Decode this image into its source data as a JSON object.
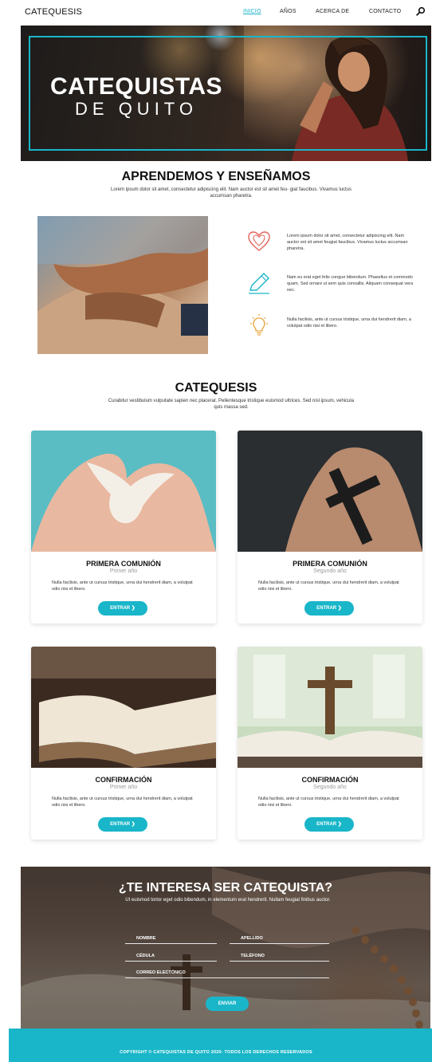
{
  "nav": {
    "brand": "CATEQUESIS",
    "items": [
      "INICIO",
      "AÑOS",
      "ACERCA DE",
      "CONTACTO"
    ],
    "active_index": 0,
    "search_icon": "search-icon"
  },
  "hero": {
    "title_line1": "CATEQUISTAS",
    "title_line2": "DE QUITO"
  },
  "about": {
    "title": "APRENDEMOS Y ENSEÑAMOS",
    "lead": "Lorem ipsum dolor sit amet, consectetur adipiscing elit. Nam auctor est sit amet feu- giat faucibus. Vivamus luctus accumsan pharetra.",
    "features": [
      {
        "icon": "hearts-icon",
        "text": "Lorem ipsum dolor sit amet, consectetur adipiscing elit. Nam auctor est sit amet feugiat faucibus. Vivamus luctus accumsan pharetra."
      },
      {
        "icon": "pencil-icon",
        "text": "Nam eu erat eget felis congue bibendum. Phasellus et commodo quam. Sed ornare ut sem quis convallis. Aliquam consequat vera nec."
      },
      {
        "icon": "lightbulb-icon",
        "text": "Nulla facilisis, ante ut cursus tristique, urna dui hendrerit diam, a volutpat odio nisi et libero."
      }
    ]
  },
  "catequesis": {
    "title": "CATEQUESIS",
    "lead": "Curabitur vestibulum vulputate sapien nec placerat. Pellentesque tristique euismod ultrices. Sed nisl ipsum, vehicula quis massa sed.",
    "cards": [
      {
        "title": "PRIMERA COMUNIÓN",
        "subtitle": "Primer año",
        "text": "Nulla facilisis, ante ut cursus tristique, urna dui hendrerit diam, a volutpat odio nisi et libero.",
        "button": "ENTRAR ❯"
      },
      {
        "title": "PRIMERA COMUNIÓN",
        "subtitle": "Segundo año",
        "text": "Nulla facilisis, ante ut cursus tristique, urna dui hendrerit diam, a volutpat odio nisi et libero.",
        "button": "ENTRAR ❯"
      },
      {
        "title": "CONFIRMACIÓN",
        "subtitle": "Primer año",
        "text": "Nulla facilisis, ante ut cursus tristique, urna dui hendrerit diam, a volutpat odio nisi et libero.",
        "button": "ENTRAR ❯"
      },
      {
        "title": "CONFIRMACIÓN",
        "subtitle": "Segundo año",
        "text": "Nulla facilisis, ante ut cursus tristique, urna dui hendrerit diam, a volutpat odio nisi et libero.",
        "button": "ENTRAR ❯"
      }
    ]
  },
  "contact": {
    "title": "¿TE INTERESA SER CATEQUISTA?",
    "lead": "Ut euismod tortor eget odio bibendum, in elementum erat hendrerit. Nullam feugiat finibus auctor.",
    "fields": {
      "nombre": "NOMBRE",
      "apellido": "APELLIDO",
      "cedula": "CÉDULA",
      "telefono": "TELÉFONO",
      "correo": "CORREO ELECTÓNICO"
    },
    "send": "ENVIAR"
  },
  "footer": {
    "text": "COPYRIGHT © CATEQUISTAS DE QUITO 2020- TODOS LOS DERECHOS RESERVADOS"
  },
  "colors": {
    "accent": "#19b6c9",
    "icon_red": "#e2655a",
    "icon_teal": "#19b6c9",
    "icon_orange": "#e6a23c"
  }
}
